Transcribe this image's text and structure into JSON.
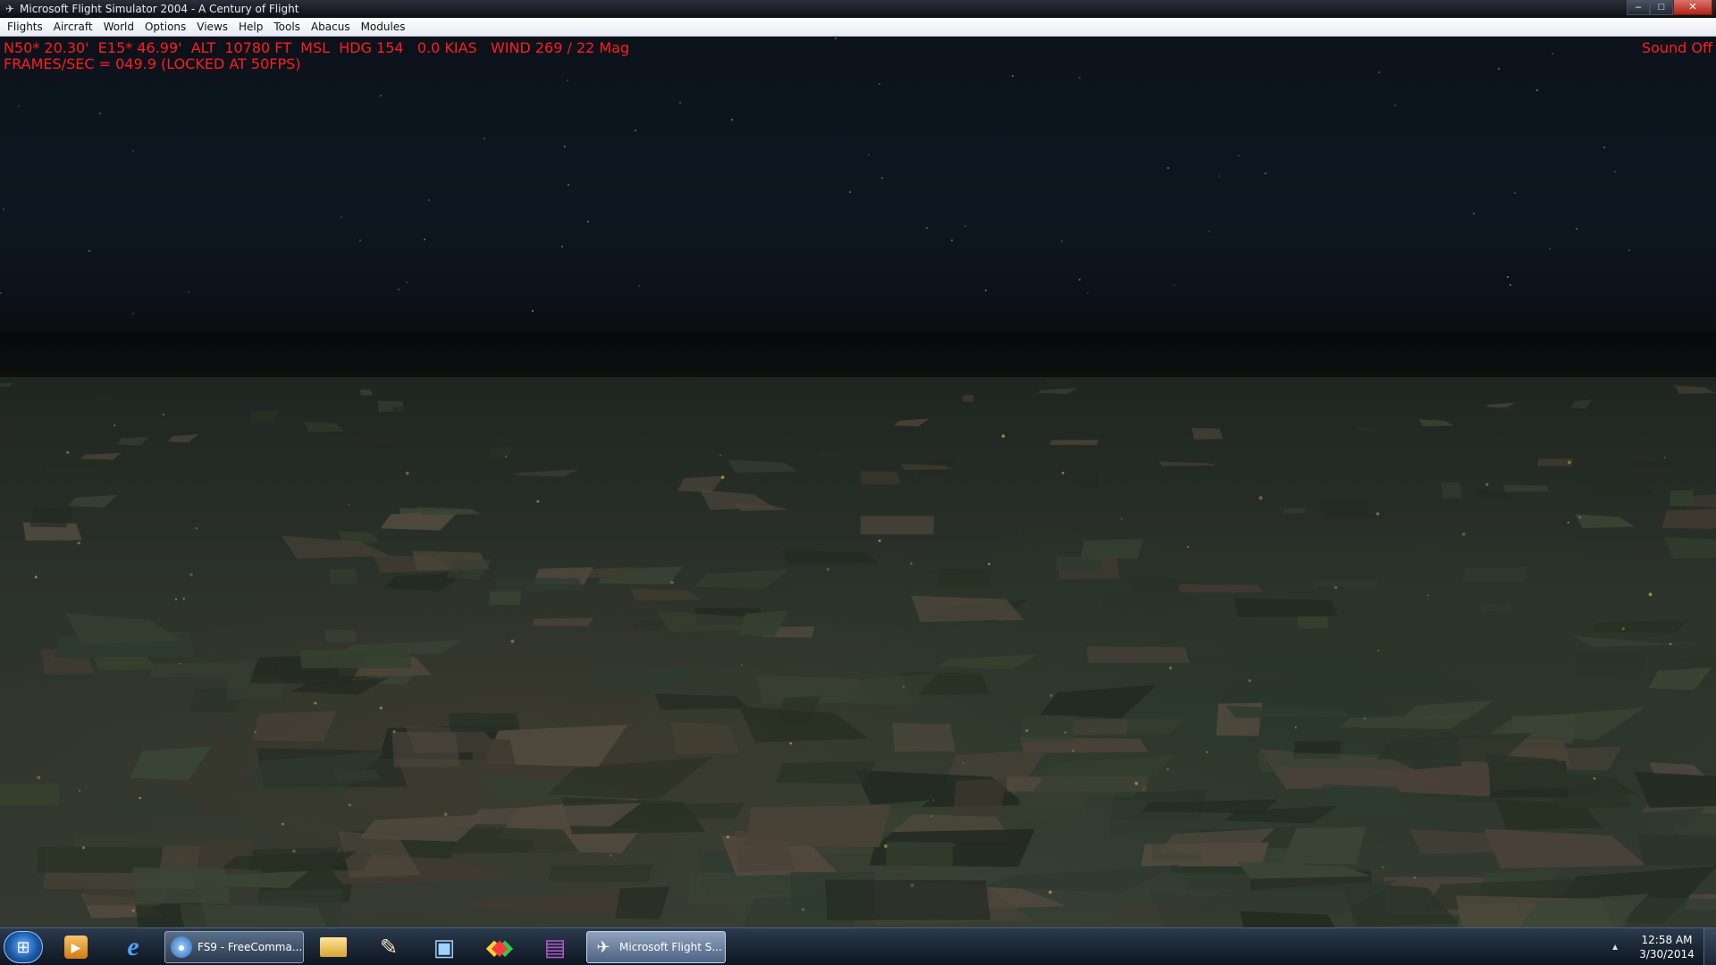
{
  "window": {
    "title": "Microsoft Flight Simulator 2004 - A Century of Flight",
    "controls": {
      "minimize": "–",
      "maximize": "□",
      "close": "✕"
    }
  },
  "menu": {
    "items": [
      "Flights",
      "Aircraft",
      "World",
      "Options",
      "Views",
      "Help",
      "Tools",
      "Abacus",
      "Modules"
    ]
  },
  "hud": {
    "line1": "N50* 20.30'  E15* 46.99'  ALT  10780 FT  MSL  HDG 154   0.0 KIAS   WIND 269 / 22 Mag",
    "line2": "FRAMES/SEC = 049.9 (LOCKED AT 50FPS)",
    "sound": "Sound Off",
    "color": "#ff1d1d"
  },
  "taskbar": {
    "start_icon": "windows-logo-icon",
    "pinned": [
      {
        "name": "media-player-icon",
        "glyph": "▶"
      },
      {
        "name": "internet-explorer-icon",
        "glyph": "e"
      }
    ],
    "tasks": [
      {
        "label": "FS9 - FreeComma...",
        "icon": "fs9-freecommander-icon",
        "active": false
      },
      {
        "label": "Microsoft Flight S...",
        "icon": "airplane-icon",
        "active": true
      }
    ],
    "pinned_after": [
      {
        "name": "file-explorer-icon",
        "glyph": "▭"
      },
      {
        "name": "paint-icon",
        "glyph": "✎"
      },
      {
        "name": "control-panel-icon",
        "glyph": "▣"
      },
      {
        "name": "colorful-app-icon",
        "glyph": "◆"
      },
      {
        "name": "winrar-icon",
        "glyph": "▤"
      }
    ],
    "clock": {
      "time": "12:58 AM",
      "date": "3/30/2014"
    }
  }
}
